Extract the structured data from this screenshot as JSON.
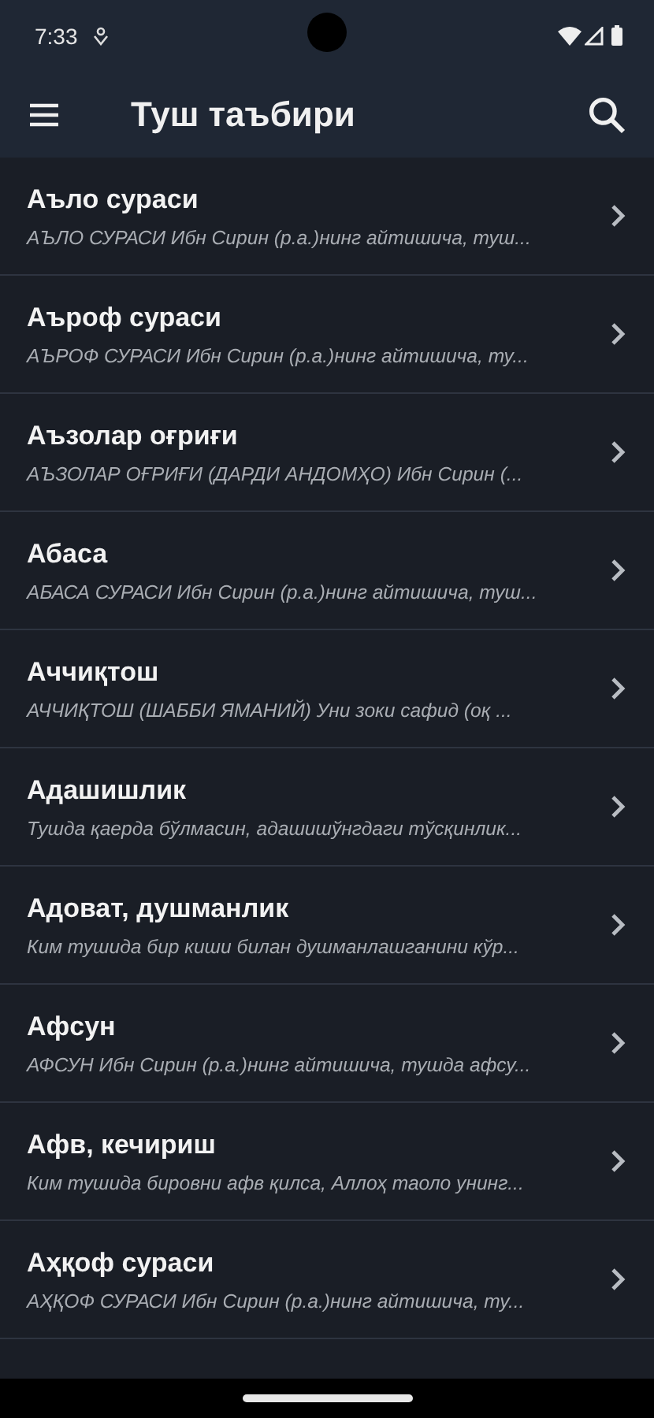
{
  "status_bar": {
    "time": "7:33"
  },
  "app_bar": {
    "title": "Туш таъбири"
  },
  "items": [
    {
      "title": "Аъло сураси",
      "subtitle": "АЪЛО СУРАСИ Ибн Сирин (р.а.)нинг айтишича, туш..."
    },
    {
      "title": "Аъроф сураси",
      "subtitle": "АЪРОФ СУРАСИ Ибн Сирин (р.а.)нинг айтишича, ту..."
    },
    {
      "title": "Аъзолар оғриғи",
      "subtitle": "АЪЗОЛАР ОҒРИҒИ (ДАРДИ АНДОМҲО) Ибн Сирин (..."
    },
    {
      "title": "Абаса",
      "subtitle": "АБАСА СУРАСИ Ибн Сирин (р.а.)нинг айтишича, туш..."
    },
    {
      "title": "Аччиқтош",
      "subtitle": "АЧЧИҚТОШ (ШАББИ ЯМАНИЙ) Уни зоки сафид (оқ ..."
    },
    {
      "title": "Адашишлик",
      "subtitle": "Тушда қаерда бўлмасин, адашишўнгдаги тўсқинлик..."
    },
    {
      "title": "Адоват, душманлик",
      "subtitle": "Ким тушида бир киши билан душманлашганини кўр..."
    },
    {
      "title": "Афсун",
      "subtitle": "АФСУН Ибн Сирин (р.а.)нинг айтишича, тушда афсу..."
    },
    {
      "title": "Афв, кечириш",
      "subtitle": "Ким тушида бировни афв қилса, Аллоҳ таоло унинг..."
    },
    {
      "title": "Аҳқоф сураси",
      "subtitle": "АҲҚОФ СУРАСИ Ибн Сирин (р.а.)нинг айтишича, ту..."
    }
  ]
}
